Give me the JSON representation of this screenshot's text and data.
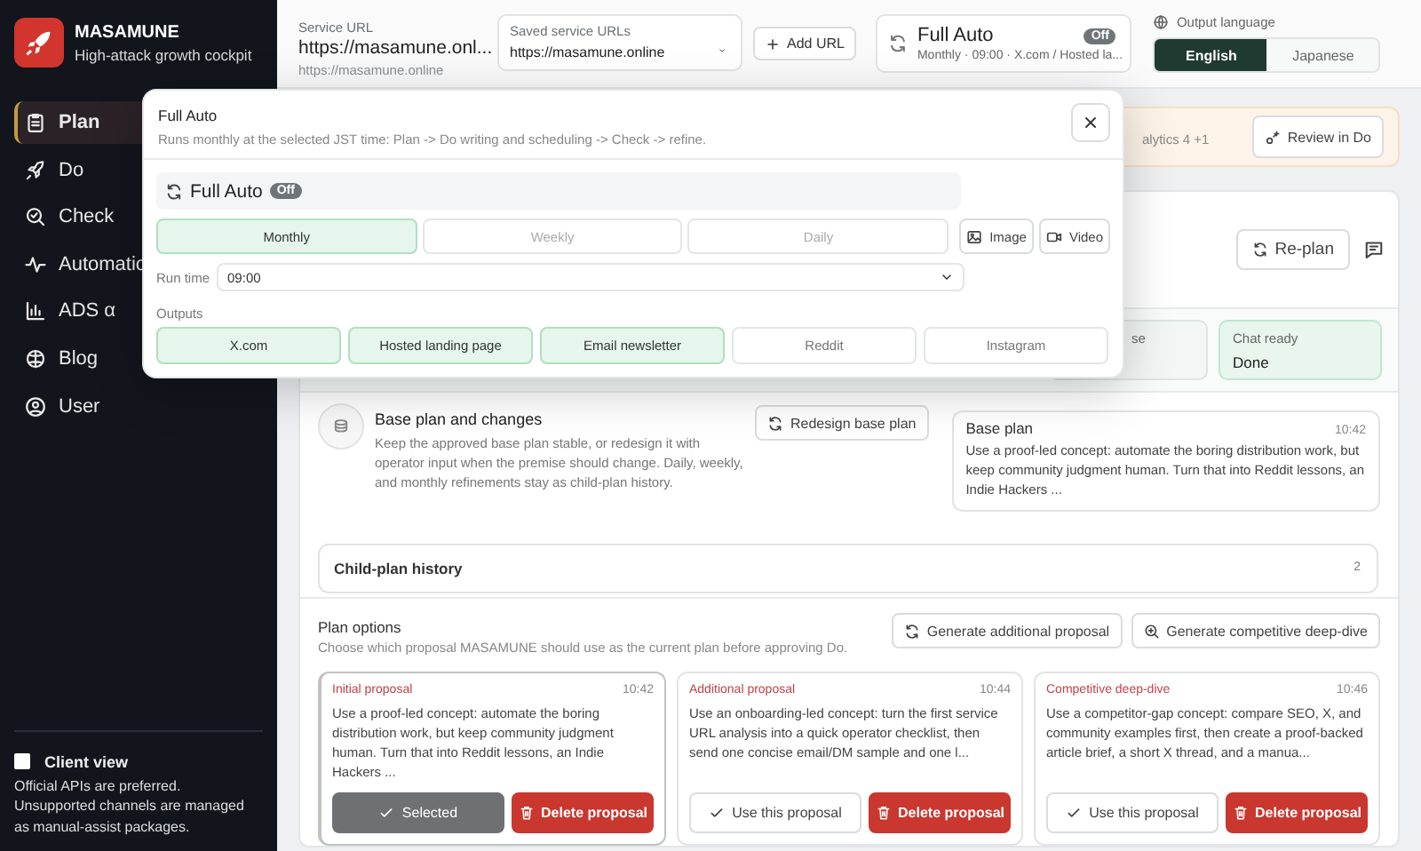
{
  "sidebar": {
    "brand": {
      "name": "MASAMUNE",
      "tagline": "High-attack growth cockpit"
    },
    "nav": [
      {
        "label": "Plan",
        "selected": true
      },
      {
        "label": "Do",
        "selected": false
      },
      {
        "label": "Check",
        "selected": false
      },
      {
        "label": "Automatio",
        "selected": false
      },
      {
        "label": "ADS α",
        "selected": false
      },
      {
        "label": "Blog",
        "selected": false
      },
      {
        "label": "User",
        "selected": false
      }
    ],
    "client_view": {
      "label": "Client view",
      "checked": false
    },
    "note": "Official APIs are preferred. Unsupported channels are managed as manual-assist packages."
  },
  "header": {
    "service_url": {
      "label": "Service URL",
      "value": "https://masamune.onl...",
      "sub": "https://masamune.online"
    },
    "saved_urls": {
      "label": "Saved service URLs",
      "value": "https://masamune.online"
    },
    "add_url": "Add URL",
    "full_auto": {
      "title": "Full Auto",
      "badge": "Off",
      "on": false,
      "summary": "Monthly · 09:00 · X.com / Hosted la..."
    },
    "output_language": {
      "label": "Output language",
      "options": [
        {
          "label": "English",
          "selected": true
        },
        {
          "label": "Japanese",
          "selected": false
        }
      ]
    }
  },
  "banner": {
    "text": "alytics 4 +1",
    "button": "Review in Do"
  },
  "plan_card": {
    "replan_button": "Re-plan",
    "tiles": [
      {
        "label": "se",
        "done": false
      },
      {
        "label": "Chat ready",
        "value": "Done",
        "done": true
      }
    ],
    "base_section": {
      "title": "Base plan and changes",
      "description": "Keep the approved base plan stable, or redesign it with operator input when the premise should change. Daily, weekly, and monthly refinements stay as child-plan history.",
      "redesign_button": "Redesign base plan",
      "base_plan": {
        "title": "Base plan",
        "time": "10:42",
        "text": "Use a proof-led concept: automate the boring distribution work, but keep community judgment human. Turn that into Reddit lessons, an Indie Hackers ..."
      }
    },
    "child_history": {
      "label": "Child-plan history",
      "count": "2"
    },
    "plan_options": {
      "title": "Plan options",
      "subtitle": "Choose which proposal MASAMUNE should use as the current plan before approving Do.",
      "buttons": [
        "Generate additional proposal",
        "Generate competitive deep-dive"
      ],
      "proposals": [
        {
          "kind_label": "Initial proposal",
          "time": "10:42",
          "text": "Use a proof-led concept: automate the boring distribution work, but keep community judgment human. Turn that into Reddit lessons, an Indie Hackers ...",
          "selected": true,
          "action": "Selected",
          "delete": "Delete proposal"
        },
        {
          "kind_label": "Additional proposal",
          "time": "10:44",
          "text": "Use an onboarding-led concept: turn the first service URL analysis into a quick operator checklist, then send one concise email/DM sample and one l...",
          "selected": false,
          "action": "Use this proposal",
          "delete": "Delete proposal"
        },
        {
          "kind_label": "Competitive deep-dive",
          "time": "10:46",
          "text": "Use a competitor-gap concept: compare SEO, X, and community examples first, then create a proof-backed article brief, a short X thread, and a manua...",
          "selected": false,
          "action": "Use this proposal",
          "delete": "Delete proposal"
        }
      ]
    }
  },
  "modal": {
    "title": "Full Auto",
    "subtitle": "Runs monthly at the selected JST time: Plan -> Do writing and scheduling -> Check -> refine.",
    "toggle": {
      "label": "Full Auto",
      "badge": "Off",
      "on": false
    },
    "frequencies": [
      {
        "label": "Monthly",
        "selected": true
      },
      {
        "label": "Weekly",
        "selected": false
      },
      {
        "label": "Daily",
        "selected": false
      }
    ],
    "media": [
      {
        "label": "Image",
        "selected": false
      },
      {
        "label": "Video",
        "selected": false
      }
    ],
    "run_time": {
      "label": "Run time",
      "value": "09:00"
    },
    "outputs_label": "Outputs",
    "outputs": [
      {
        "label": "X.com",
        "selected": true
      },
      {
        "label": "Hosted landing page",
        "selected": true
      },
      {
        "label": "Email newsletter",
        "selected": true
      },
      {
        "label": "Reddit",
        "selected": false
      },
      {
        "label": "Instagram",
        "selected": false
      }
    ]
  }
}
